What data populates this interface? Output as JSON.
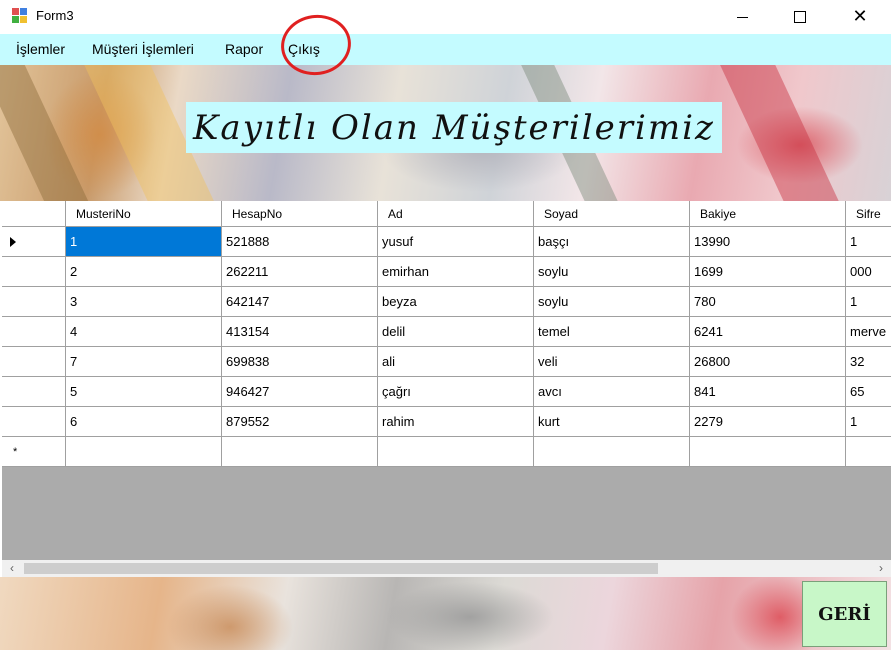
{
  "window": {
    "title": "Form3"
  },
  "menu": {
    "items": [
      "İşlemler",
      "Müşteri İşlemleri",
      "Rapor",
      "Çıkış"
    ]
  },
  "banner": {
    "title": "Kayıtlı Olan Müşterilerimiz"
  },
  "grid": {
    "columns": [
      "MusteriNo",
      "HesapNo",
      "Ad",
      "Soyad",
      "Bakiye",
      "Sifre"
    ],
    "rows": [
      [
        "1",
        "521888",
        "yusuf",
        "başçı",
        "13990",
        "1"
      ],
      [
        "2",
        "262211",
        "emirhan",
        "soylu",
        "1699",
        "000"
      ],
      [
        "3",
        "642147",
        "beyza",
        "soylu",
        "780",
        "1"
      ],
      [
        "4",
        "413154",
        "delil",
        "temel",
        "6241",
        "merve"
      ],
      [
        "7",
        "699838",
        "ali",
        "veli",
        "26800",
        "32"
      ],
      [
        "5",
        "946427",
        "çağrı",
        "avcı",
        "841",
        "65"
      ],
      [
        "6",
        "879552",
        "rahim",
        "kurt",
        "2279",
        "1"
      ]
    ],
    "new_row_marker": "*"
  },
  "buttons": {
    "back": "GERİ"
  },
  "colors": {
    "menu_bg": "#c4fbff",
    "selection": "#0078d7",
    "back_button": "#c8f7c8",
    "annotation": "#e02020"
  }
}
